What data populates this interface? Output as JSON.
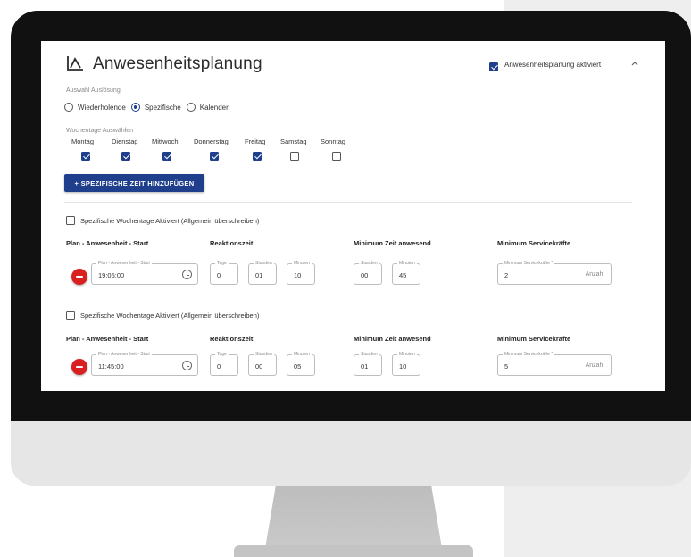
{
  "header": {
    "title": "Anwesenheitsplanung",
    "title_icon": "line-chart-icon",
    "active_checkbox_label": "Anwesenheitsplanung aktiviert",
    "active_checked": true,
    "collapse_icon": "chevron-up-icon"
  },
  "trigger": {
    "label": "Auswahl Auslösung",
    "options": [
      {
        "label": "Wiederholende",
        "selected": false
      },
      {
        "label": "Spezifische",
        "selected": true
      },
      {
        "label": "Kalender",
        "selected": false
      }
    ]
  },
  "weekdays": {
    "label": "Wochentage Auswählen",
    "days": [
      {
        "label": "Montag",
        "checked": true
      },
      {
        "label": "Dienstag",
        "checked": true
      },
      {
        "label": "Mittwoch",
        "checked": true
      },
      {
        "label": "Donnerstag",
        "checked": true
      },
      {
        "label": "Freitag",
        "checked": true
      },
      {
        "label": "Samstag",
        "checked": false
      },
      {
        "label": "Sonntag",
        "checked": false
      }
    ]
  },
  "add_button": {
    "label": "+ SPEZIFISCHE ZEIT HINZUFÜGEN"
  },
  "columns": {
    "start": "Plan - Anwesenheit - Start",
    "reaction": "Reaktionszeit",
    "min_time": "Minimum Zeit anwesend",
    "min_staff": "Minimum Servicekräfte"
  },
  "field_labels": {
    "start": "Plan - Anwesenheit - Start",
    "days": "Tage",
    "hours": "Stunden",
    "minutes": "Minuten",
    "min_staff": "Minimum Servicekräfte *",
    "unit": "Anzahl"
  },
  "entries": [
    {
      "override_label": "Spezifische Wochentage Aktiviert (Allgemein überschreiben)",
      "start": "19:05:00",
      "reaction_days": "0",
      "reaction_hours": "01",
      "reaction_minutes": "10",
      "min_hours": "00",
      "min_minutes": "45",
      "min_staff": "2"
    },
    {
      "override_label": "Spezifische Wochentage Aktiviert (Allgemein überschreiben)",
      "start": "11:45:00",
      "reaction_days": "0",
      "reaction_hours": "00",
      "reaction_minutes": "05",
      "min_hours": "01",
      "min_minutes": "10",
      "min_staff": "5"
    }
  ],
  "colors": {
    "accent": "#1f3f8c",
    "remove": "#d92020",
    "bezel": "#111111"
  }
}
